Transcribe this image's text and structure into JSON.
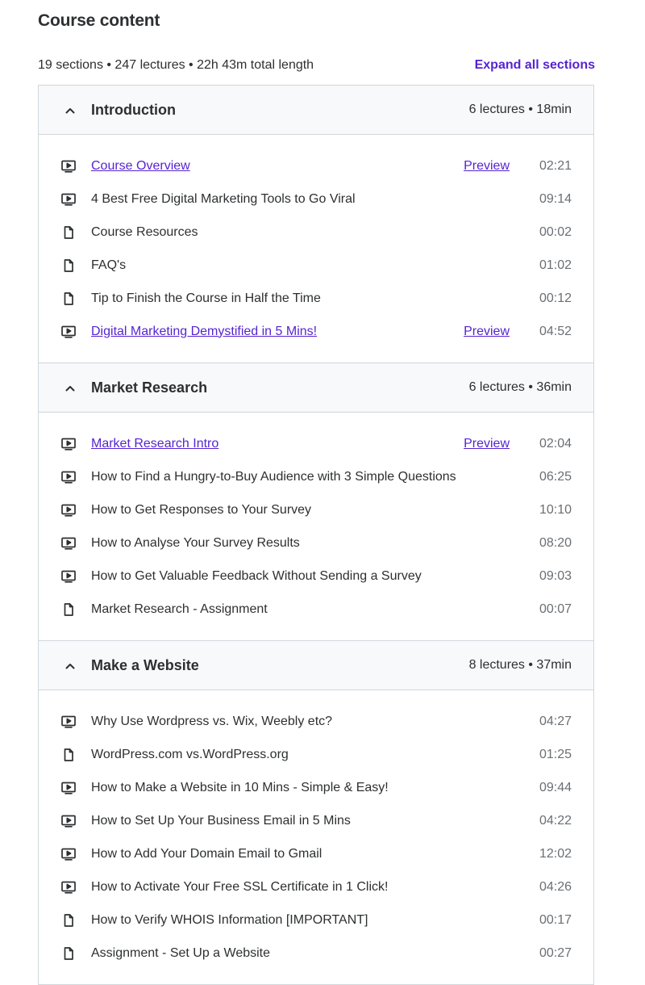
{
  "page": {
    "title": "Course content",
    "stats": "19 sections • 247 lectures • 22h 43m total length",
    "expand_label": "Expand all sections"
  },
  "colors": {
    "link": "#5624d0",
    "header_bg": "#f7f9fa",
    "border": "#d1d7dc"
  },
  "icons": {
    "video": "play-video-icon",
    "file": "file-icon",
    "collapse": "chevron-up-icon"
  },
  "sections": [
    {
      "title": "Introduction",
      "meta": "6 lectures • 18min",
      "items": [
        {
          "type": "video",
          "title": "Course Overview",
          "link": true,
          "preview": "Preview",
          "duration": "02:21"
        },
        {
          "type": "video",
          "title": "4 Best Free Digital Marketing Tools to Go Viral",
          "link": false,
          "preview": "",
          "duration": "09:14"
        },
        {
          "type": "file",
          "title": "Course Resources",
          "link": false,
          "preview": "",
          "duration": "00:02"
        },
        {
          "type": "file",
          "title": "FAQ's",
          "link": false,
          "preview": "",
          "duration": "01:02"
        },
        {
          "type": "file",
          "title": "Tip to Finish the Course in Half the Time",
          "link": false,
          "preview": "",
          "duration": "00:12"
        },
        {
          "type": "video",
          "title": "Digital Marketing Demystified in 5 Mins!",
          "link": true,
          "preview": "Preview",
          "duration": "04:52"
        }
      ]
    },
    {
      "title": "Market Research",
      "meta": "6 lectures • 36min",
      "items": [
        {
          "type": "video",
          "title": "Market Research Intro",
          "link": true,
          "preview": "Preview",
          "duration": "02:04"
        },
        {
          "type": "video",
          "title": "How to Find a Hungry-to-Buy Audience with 3 Simple Questions",
          "link": false,
          "preview": "",
          "duration": "06:25"
        },
        {
          "type": "video",
          "title": "How to Get Responses to Your Survey",
          "link": false,
          "preview": "",
          "duration": "10:10"
        },
        {
          "type": "video",
          "title": "How to Analyse Your Survey Results",
          "link": false,
          "preview": "",
          "duration": "08:20"
        },
        {
          "type": "video",
          "title": "How to Get Valuable Feedback Without Sending a Survey",
          "link": false,
          "preview": "",
          "duration": "09:03"
        },
        {
          "type": "file",
          "title": "Market Research - Assignment",
          "link": false,
          "preview": "",
          "duration": "00:07"
        }
      ]
    },
    {
      "title": "Make a Website",
      "meta": "8 lectures • 37min",
      "items": [
        {
          "type": "video",
          "title": "Why Use Wordpress vs. Wix, Weebly etc?",
          "link": false,
          "preview": "",
          "duration": "04:27"
        },
        {
          "type": "file",
          "title": "WordPress.com vs.WordPress.org",
          "link": false,
          "preview": "",
          "duration": "01:25"
        },
        {
          "type": "video",
          "title": "How to Make a Website in 10 Mins - Simple & Easy!",
          "link": false,
          "preview": "",
          "duration": "09:44"
        },
        {
          "type": "video",
          "title": "How to Set Up Your Business Email in 5 Mins",
          "link": false,
          "preview": "",
          "duration": "04:22"
        },
        {
          "type": "video",
          "title": "How to Add Your Domain Email to Gmail",
          "link": false,
          "preview": "",
          "duration": "12:02"
        },
        {
          "type": "video",
          "title": "How to Activate Your Free SSL Certificate in 1 Click!",
          "link": false,
          "preview": "",
          "duration": "04:26"
        },
        {
          "type": "file",
          "title": "How to Verify WHOIS Information [IMPORTANT]",
          "link": false,
          "preview": "",
          "duration": "00:17"
        },
        {
          "type": "file",
          "title": "Assignment - Set Up a Website",
          "link": false,
          "preview": "",
          "duration": "00:27"
        }
      ]
    }
  ]
}
